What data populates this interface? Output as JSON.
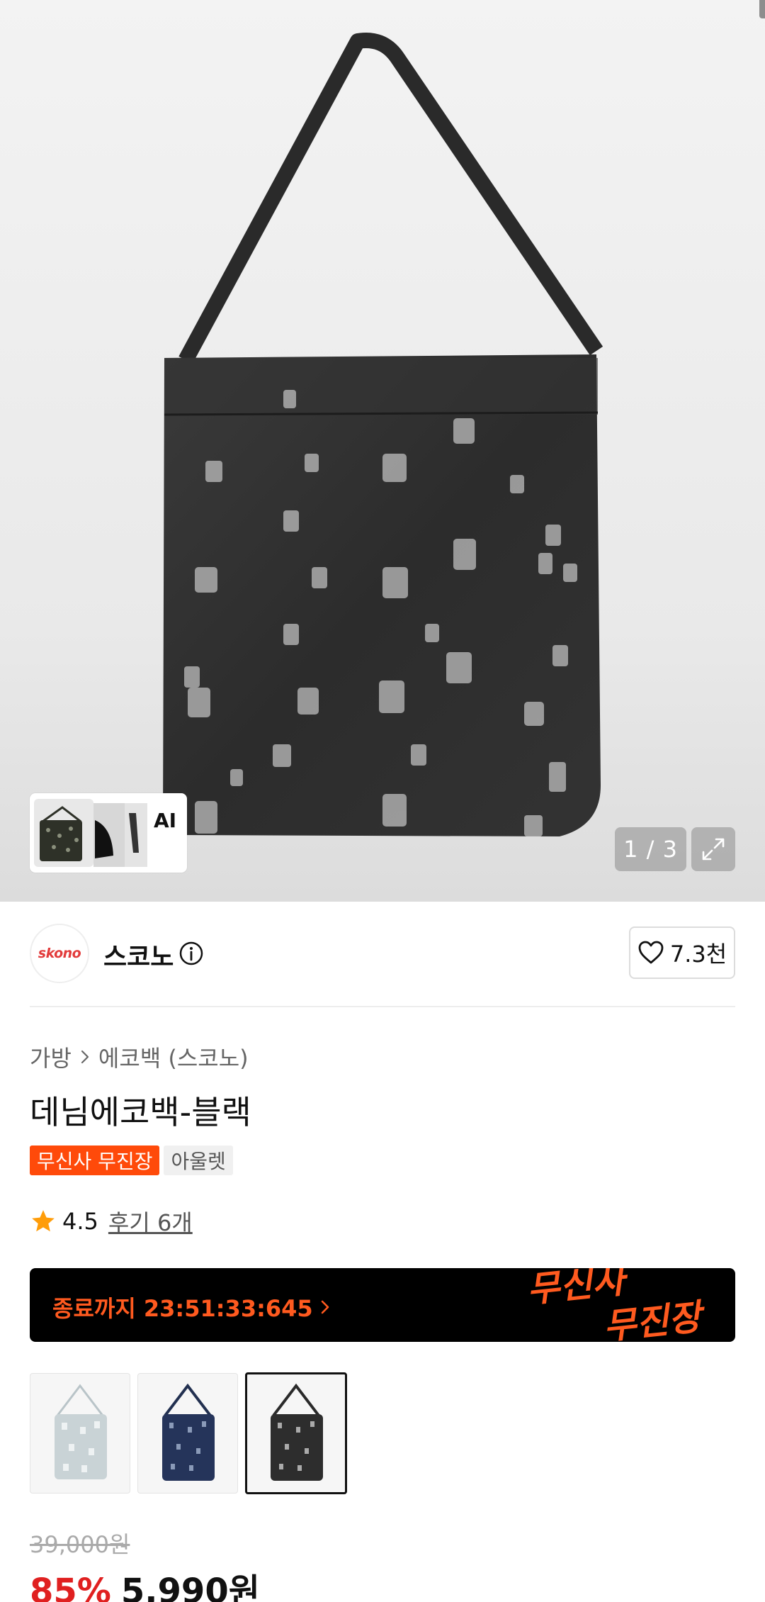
{
  "gallery": {
    "counter": "1 / 3",
    "ai_label": "AI",
    "icons": [
      "chevron-right-icon",
      "expand-icon"
    ]
  },
  "brand": {
    "logo_text": "skono",
    "name": "스코노",
    "likes": "7.3천",
    "icons": [
      "info-icon",
      "heart-icon"
    ]
  },
  "product": {
    "breadcrumb": [
      "가방",
      "에코백 (스코노)"
    ],
    "title": "데님에코백-블랙",
    "tags": [
      "무신사 무진장",
      "아울렛"
    ],
    "rating": "4.5",
    "reviews": "후기 6개"
  },
  "promo": {
    "timer_text": "종료까지 23:51:33:645",
    "logo_line1": "무신사",
    "logo_line2": "무진장",
    "accent": "#ff5a1f"
  },
  "price": {
    "original": "39,000원",
    "discount": "85%",
    "final": "5,990원",
    "discount_color": "#e02020"
  }
}
